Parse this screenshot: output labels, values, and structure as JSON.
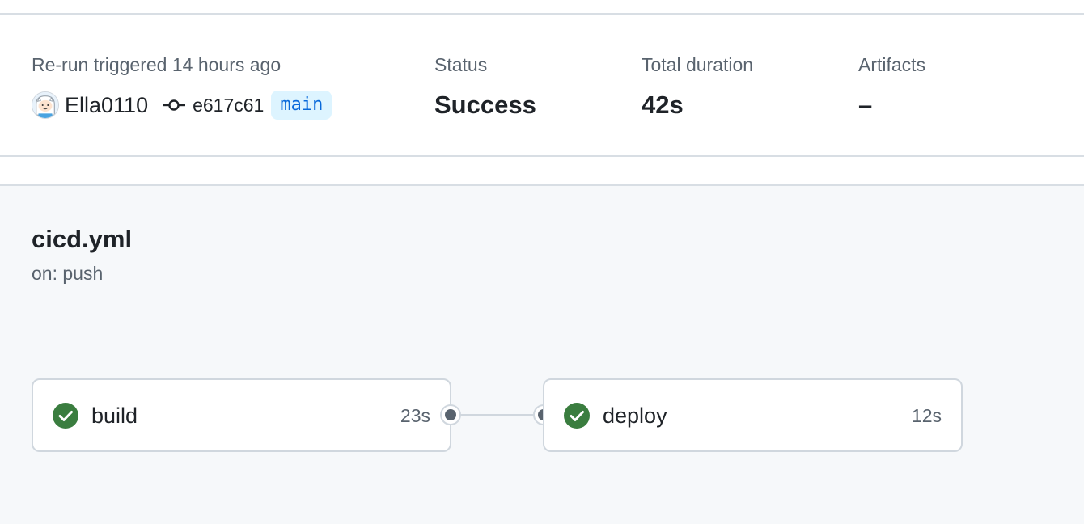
{
  "summary": {
    "trigger_label": "Re-run triggered 14 hours ago",
    "actor": "Ella0110",
    "commit_sha": "e617c61",
    "branch": "main",
    "status_label": "Status",
    "status_value": "Success",
    "duration_label": "Total duration",
    "duration_value": "42s",
    "artifacts_label": "Artifacts",
    "artifacts_value": "–"
  },
  "workflow": {
    "file": "cicd.yml",
    "trigger": "on: push",
    "jobs": [
      {
        "name": "build",
        "duration": "23s",
        "status": "success",
        "icon": "check-circle-icon"
      },
      {
        "name": "deploy",
        "duration": "12s",
        "status": "success",
        "icon": "check-circle-icon"
      }
    ]
  },
  "colors": {
    "success": "#1a7f37",
    "success_dark": "#3a7d3f",
    "branch_bg": "#ddf4ff",
    "branch_fg": "#0969da",
    "muted_text": "#59636e",
    "panel_bg": "#f6f8fa",
    "border": "#d0d7de"
  },
  "icons": {
    "avatar": "finn-avatar-icon",
    "commit": "git-commit-icon",
    "job_status": "check-circle-icon",
    "connector": "connector-dot-icon"
  }
}
